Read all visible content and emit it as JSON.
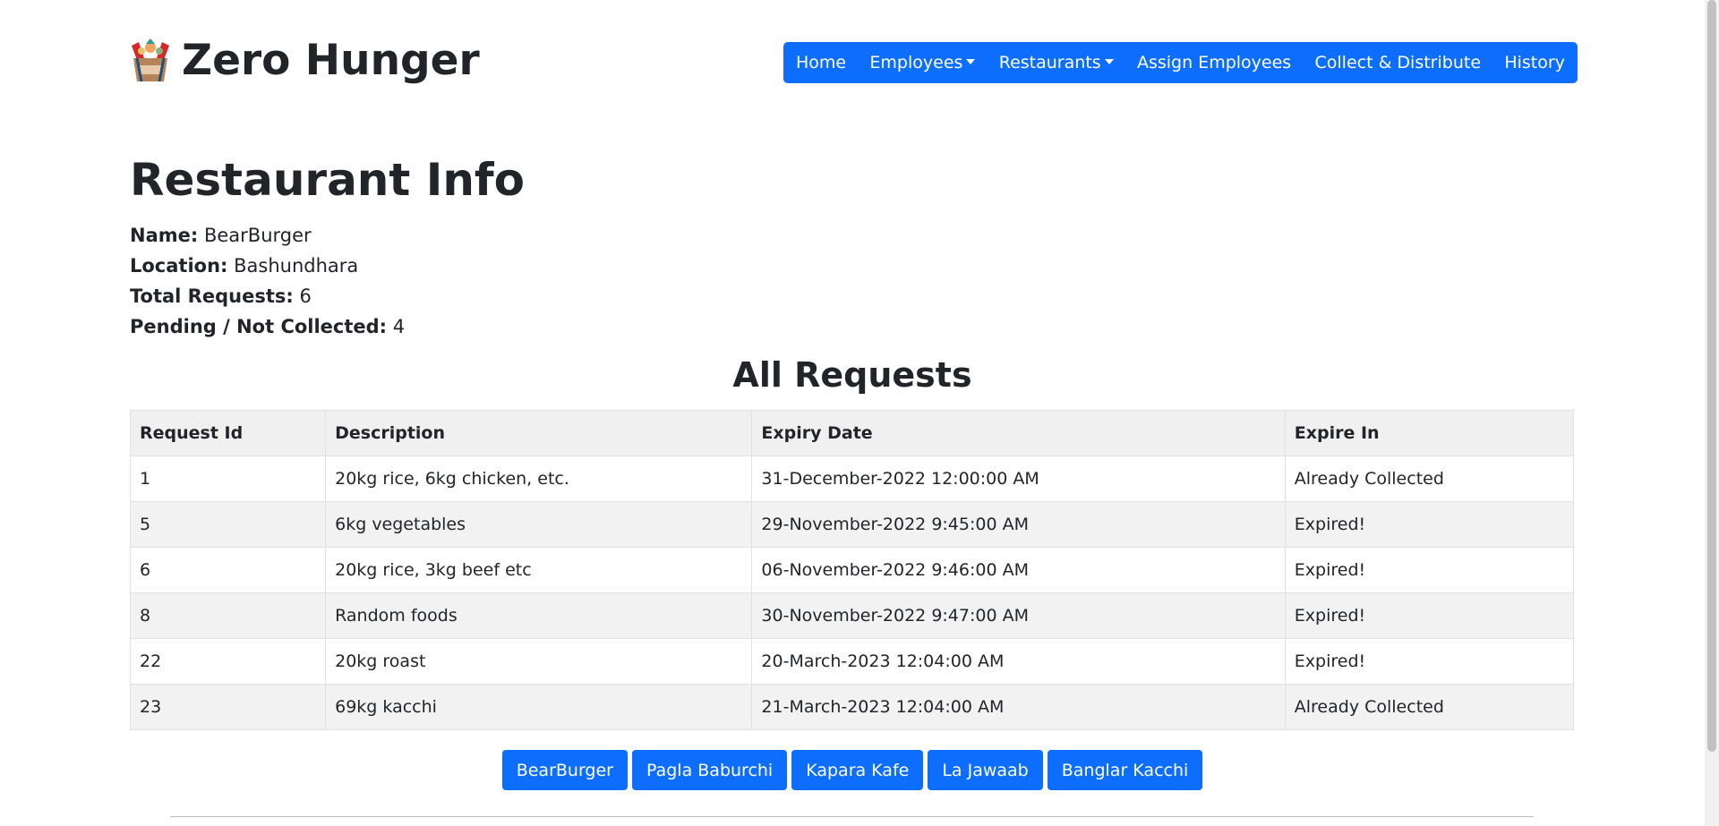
{
  "brand": {
    "name": "Zero Hunger",
    "logo_icon": "food-basket-icon"
  },
  "nav": {
    "items": [
      {
        "label": "Home",
        "dropdown": false
      },
      {
        "label": "Employees",
        "dropdown": true
      },
      {
        "label": "Restaurants",
        "dropdown": true
      },
      {
        "label": "Assign Employees",
        "dropdown": false
      },
      {
        "label": "Collect & Distribute",
        "dropdown": false
      },
      {
        "label": "History",
        "dropdown": false
      }
    ]
  },
  "page": {
    "title": "Restaurant Info"
  },
  "info": {
    "name_label": "Name:",
    "name_value": "BearBurger",
    "location_label": "Location:",
    "location_value": "Bashundhara",
    "total_label": "Total Requests:",
    "total_value": "6",
    "pending_label": "Pending / Not Collected:",
    "pending_value": "4"
  },
  "requests": {
    "title": "All Requests",
    "columns": [
      "Request Id",
      "Description",
      "Expiry Date",
      "Expire In"
    ],
    "rows": [
      [
        "1",
        "20kg rice, 6kg chicken, etc.",
        "31-December-2022 12:00:00 AM",
        "Already Collected"
      ],
      [
        "5",
        "6kg vegetables",
        "29-November-2022 9:45:00 AM",
        "Expired!"
      ],
      [
        "6",
        "20kg rice, 3kg beef etc",
        "06-November-2022 9:46:00 AM",
        "Expired!"
      ],
      [
        "8",
        "Random foods",
        "30-November-2022 9:47:00 AM",
        "Expired!"
      ],
      [
        "22",
        "20kg roast",
        "20-March-2023 12:04:00 AM",
        "Expired!"
      ],
      [
        "23",
        "69kg kacchi",
        "21-March-2023 12:04:00 AM",
        "Already Collected"
      ]
    ]
  },
  "restaurant_buttons": [
    "BearBurger",
    "Pagla Baburchi",
    "Kapara Kafe",
    "La Jawaab",
    "Banglar Kacchi"
  ],
  "colors": {
    "primary": "#0d6efd",
    "text": "#212529",
    "stripe": "#f2f2f2",
    "header_bg": "#f0f0f0"
  }
}
